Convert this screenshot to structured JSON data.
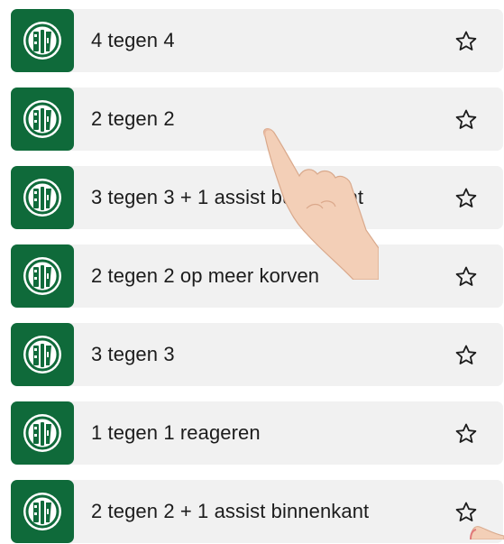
{
  "exercises": [
    {
      "title": "4 tegen 4"
    },
    {
      "title": "2 tegen 2"
    },
    {
      "title": "3 tegen 3 + 1 assist buitenkant"
    },
    {
      "title": "2 tegen 2 op meer korven"
    },
    {
      "title": "3 tegen 3"
    },
    {
      "title": "1 tegen 1 reageren"
    },
    {
      "title": "2 tegen 2 + 1 assist binnenkant"
    }
  ],
  "colors": {
    "logo_bg": "#0f6a3a",
    "row_bg": "#f1f1f1",
    "text": "#1c1c1c"
  },
  "icons": {
    "logo": "korfball-club-logo-icon",
    "favorite": "star-outline-icon"
  }
}
